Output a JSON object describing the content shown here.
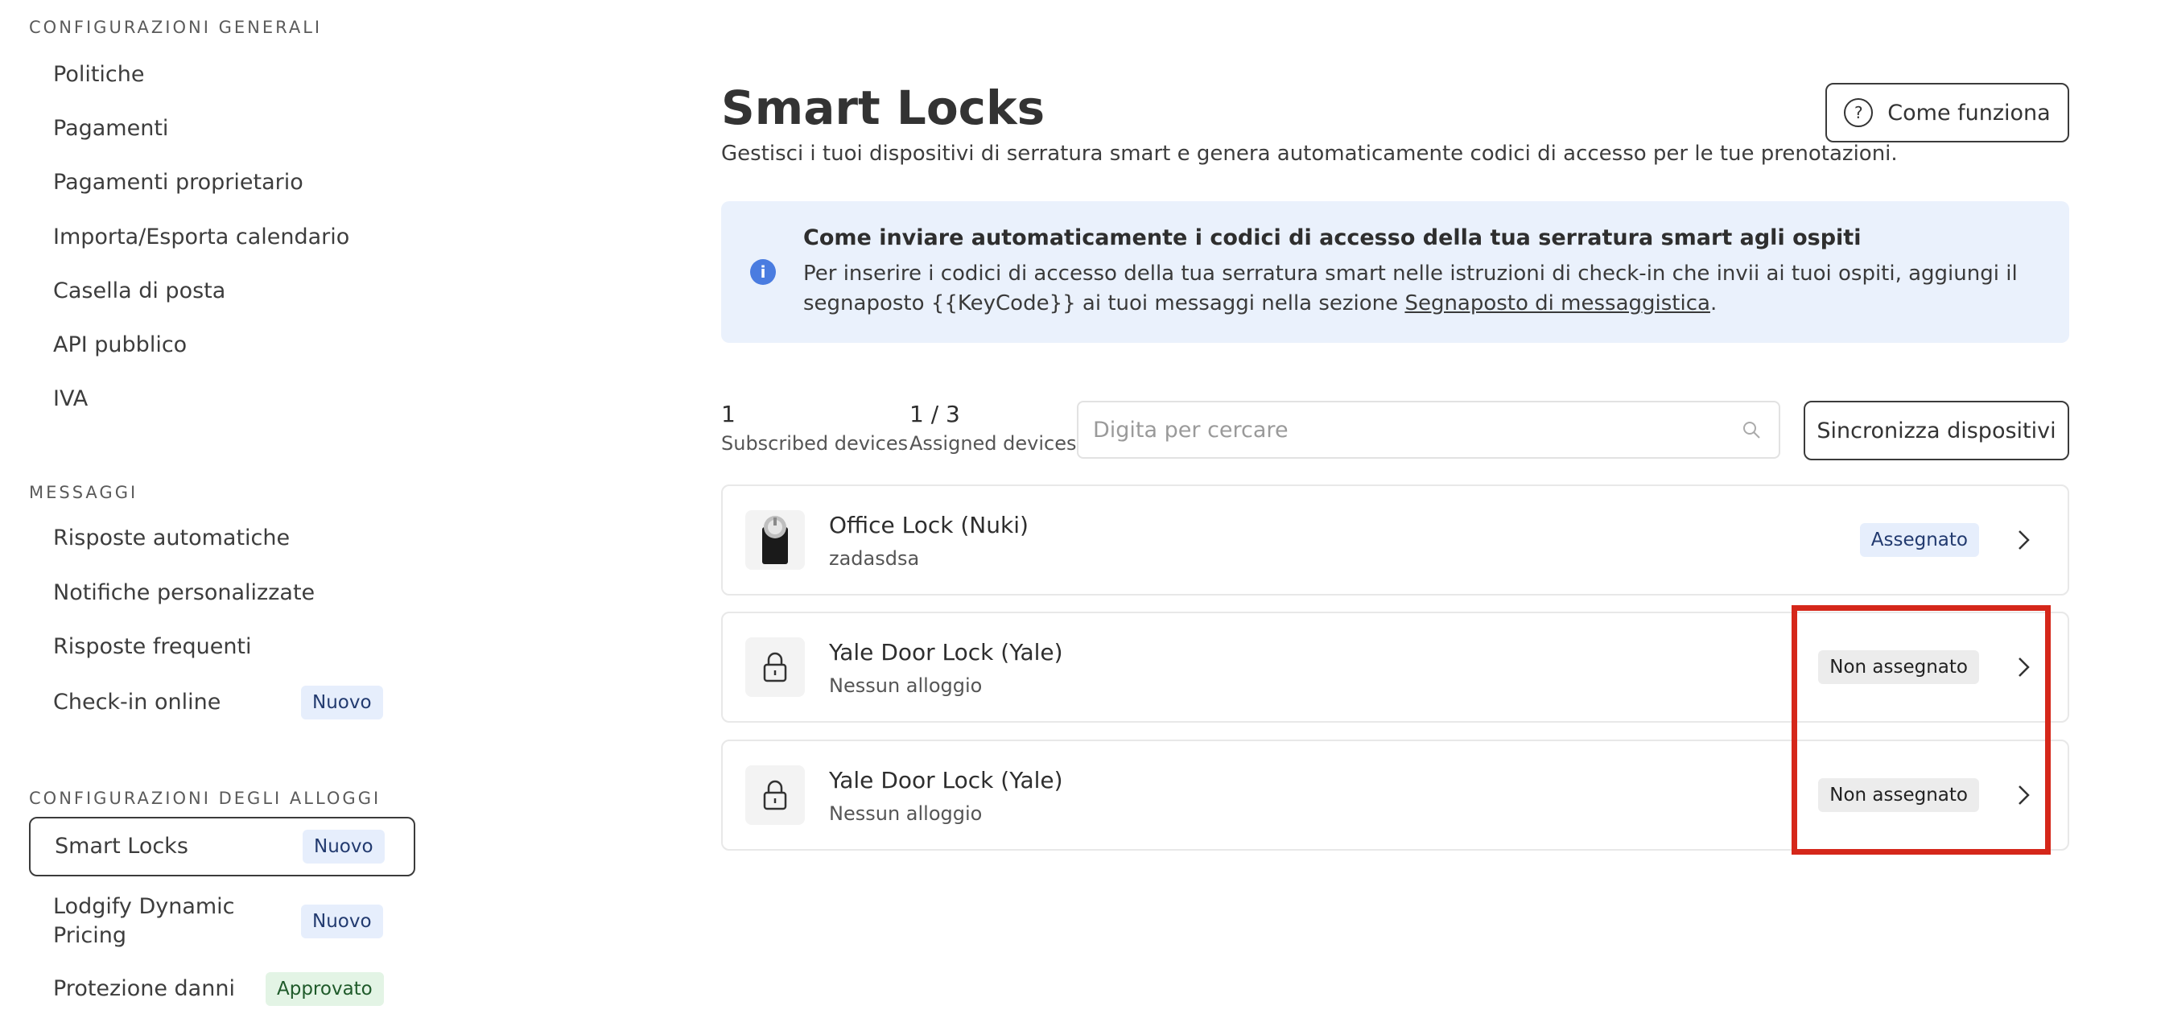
{
  "sidebar": {
    "sections": [
      {
        "title": "CONFIGURAZIONI GENERALI",
        "items": [
          {
            "label": "Politiche"
          },
          {
            "label": "Pagamenti"
          },
          {
            "label": "Pagamenti proprietario"
          },
          {
            "label": "Importa/Esporta calendario"
          },
          {
            "label": "Casella di posta"
          },
          {
            "label": "API pubblico"
          },
          {
            "label": "IVA"
          }
        ]
      },
      {
        "title": "MESSAGGI",
        "items": [
          {
            "label": "Risposte automatiche"
          },
          {
            "label": "Notifiche personalizzate"
          },
          {
            "label": "Risposte frequenti"
          },
          {
            "label": "Check-in online",
            "badge": "Nuovo"
          }
        ]
      },
      {
        "title": "CONFIGURAZIONI DEGLI ALLOGGI",
        "items": [
          {
            "label": "Smart Locks",
            "badge": "Nuovo",
            "active": true
          },
          {
            "label": "Lodgify Dynamic Pricing",
            "badge": "Nuovo"
          },
          {
            "label": "Protezione danni",
            "badge": "Approvato"
          }
        ]
      }
    ]
  },
  "page": {
    "title": "Smart Locks",
    "subtitle": "Gestisci i tuoi dispositivi di serratura smart e genera automaticamente codici di accesso per le tue prenotazioni.",
    "how_button": "Come funziona"
  },
  "info_box": {
    "heading": "Come inviare automaticamente i codici di accesso della tua serratura smart agli ospiti",
    "body_prefix": "Per inserire i codici di accesso della tua serratura smart nelle istruzioni di check-in che invii ai tuoi ospiti, aggiungi il segnaposto {{KeyCode}} ai tuoi messaggi nella sezione ",
    "link": "Segnaposto di messaggistica",
    "body_suffix": "."
  },
  "stats": {
    "subscribed_value": "1",
    "subscribed_label": "Subscribed devices",
    "assigned_value": "1 / 3",
    "assigned_label": "Assigned devices"
  },
  "search": {
    "placeholder": "Digita per cercare",
    "value": ""
  },
  "sync_button": "Sincronizza dispositivi",
  "devices": [
    {
      "name": "Office Lock (Nuki)",
      "sub": "zadasdsa",
      "status": "Assegnato",
      "icon": "nuki-device-icon"
    },
    {
      "name": "Yale Door Lock (Yale)",
      "sub": "Nessun alloggio",
      "status": "Non assegnato",
      "icon": "lock-icon"
    },
    {
      "name": "Yale Door Lock (Yale)",
      "sub": "Nessun alloggio",
      "status": "Non assegnato",
      "icon": "lock-icon"
    }
  ],
  "colors": {
    "highlight": "#d5271a",
    "info_bg": "#eaf1fc",
    "info_icon": "#4a7ce0",
    "badge_new_bg": "#e6eefc",
    "badge_approved_bg": "#e3f4e5"
  }
}
